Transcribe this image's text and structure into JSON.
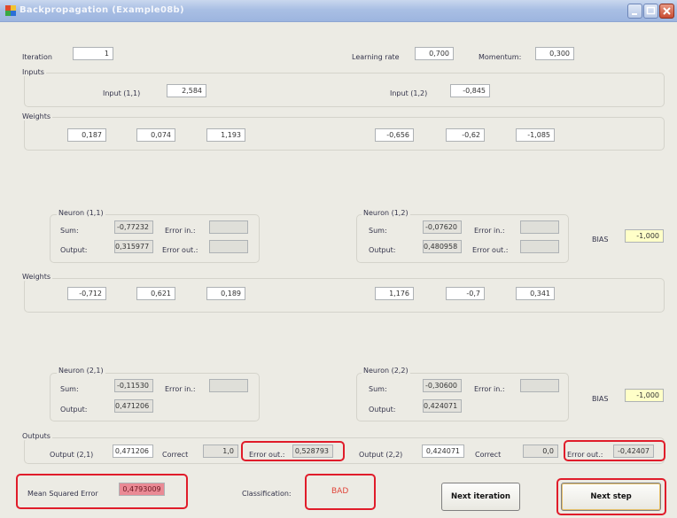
{
  "window": {
    "title": "Backpropagation (Example08b)"
  },
  "top": {
    "iteration_label": "Iteration",
    "iteration": "1",
    "lr_label": "Learning rate",
    "lr": "0,700",
    "momentum_label": "Momentum:",
    "momentum": "0,300"
  },
  "inputs": {
    "title": "Inputs",
    "in1_label": "Input (1,1)",
    "in1": "2,584",
    "in2_label": "Input (1,2)",
    "in2": "-0,845"
  },
  "weights1": {
    "title": "Weights",
    "w": [
      "0,187",
      "0,074",
      "1,193",
      "-0,656",
      "-0,62",
      "-1,085"
    ]
  },
  "n11": {
    "title": "Neuron (1,1)",
    "sum_label": "Sum:",
    "sum": "-0,77232",
    "out_label": "Output:",
    "out": "0,315977",
    "ein_label": "Error in.:",
    "eout_label": "Error out.:"
  },
  "n12": {
    "title": "Neuron (1,2)",
    "sum_label": "Sum:",
    "sum": "-0,07620",
    "out_label": "Output:",
    "out": "0,480958",
    "ein_label": "Error in.:",
    "eout_label": "Error out.:"
  },
  "bias1": {
    "label": "BIAS",
    "value": "-1,000"
  },
  "weights2": {
    "title": "Weights",
    "w": [
      "-0,712",
      "0,621",
      "0,189",
      "1,176",
      "-0,7",
      "0,341"
    ]
  },
  "n21": {
    "title": "Neuron (2,1)",
    "sum_label": "Sum:",
    "sum": "-0,11530",
    "out_label": "Output:",
    "out": "0,471206",
    "ein_label": "Error in.:"
  },
  "n22": {
    "title": "Neuron (2,2)",
    "sum_label": "Sum:",
    "sum": "-0,30600",
    "out_label": "Output:",
    "out": "0,424071",
    "ein_label": "Error in.:"
  },
  "bias2": {
    "label": "BIAS",
    "value": "-1,000"
  },
  "outputs": {
    "title": "Outputs",
    "o1_label": "Output (2,1)",
    "o1": "0,471206",
    "c1_label": "Correct",
    "c1": "1,0",
    "e1_label": "Error out.:",
    "e1": "0,528793",
    "o2_label": "Output (2,2)",
    "o2": "0,424071",
    "c2_label": "Correct",
    "c2": "0,0",
    "e2_label": "Error out.:",
    "e2": "-0,42407"
  },
  "bottom": {
    "mse_label": "Mean Squared Error",
    "mse": "0,4793009",
    "class_label": "Classification:",
    "class_value": "BAD",
    "next_iter": "Next iteration",
    "next_step": "Next step"
  },
  "colors": {
    "highlight": "#e01c2a",
    "mse_bg": "#ea8a95",
    "bias_bg": "#ffffc8"
  },
  "icons": {
    "app": "app-icon",
    "minimize": "minimize-icon",
    "maximize": "maximize-icon",
    "close": "close-icon"
  }
}
